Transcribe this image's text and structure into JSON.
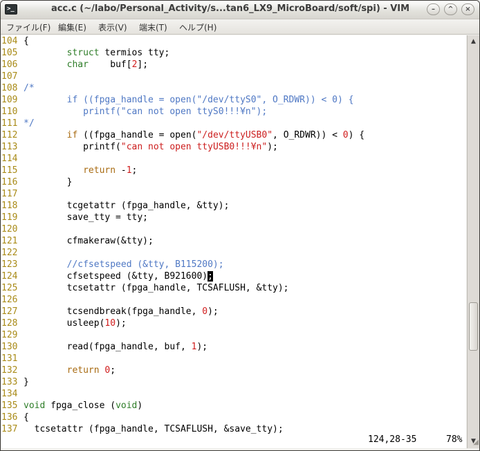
{
  "window": {
    "title": "acc.c (~/labo/Personal_Activity/s...tan6_LX9_MicroBoard/soft/spi) - VIM",
    "app_icon_glyph": ">_",
    "buttons": {
      "minimize": "–",
      "maximize": "^",
      "close": "×"
    }
  },
  "menu": [
    "ファイル(F)",
    "編集(E)",
    "表示(V)",
    "端末(T)",
    "ヘルプ(H)"
  ],
  "colors": {
    "line_number": "#a98b18",
    "type": "#2e7d28",
    "keyword": "#a86b12",
    "number": "#d01c1c",
    "string": "#cc1e1e",
    "comment": "#4f78c4"
  },
  "editor": {
    "lines": [
      {
        "n": "104",
        "seg": [
          {
            "t": "{"
          }
        ]
      },
      {
        "n": "105",
        "seg": [
          {
            "t": "        "
          },
          {
            "t": "struct",
            "c": "type"
          },
          {
            "t": " termios tty;"
          }
        ]
      },
      {
        "n": "106",
        "seg": [
          {
            "t": "        "
          },
          {
            "t": "char",
            "c": "type"
          },
          {
            "t": "    buf["
          },
          {
            "t": "2",
            "c": "num"
          },
          {
            "t": "];"
          }
        ]
      },
      {
        "n": "107",
        "seg": [
          {
            "t": ""
          }
        ]
      },
      {
        "n": "108",
        "seg": [
          {
            "t": "/*",
            "c": "cmt"
          }
        ]
      },
      {
        "n": "109",
        "seg": [
          {
            "t": "        if ((fpga_handle = open(\"/dev/ttyS0\", O_RDWR)) < 0) {",
            "c": "cmt"
          }
        ]
      },
      {
        "n": "110",
        "seg": [
          {
            "t": "           printf(\"can not open ttyS0!!!¥n\");",
            "c": "cmt"
          }
        ]
      },
      {
        "n": "111",
        "seg": [
          {
            "t": "*/",
            "c": "cmt"
          }
        ]
      },
      {
        "n": "112",
        "seg": [
          {
            "t": "        "
          },
          {
            "t": "if",
            "c": "kw"
          },
          {
            "t": " ((fpga_handle = open("
          },
          {
            "t": "\"/dev/ttyUSB0\"",
            "c": "str"
          },
          {
            "t": ", O_RDWR)) < "
          },
          {
            "t": "0",
            "c": "num"
          },
          {
            "t": ") {"
          }
        ]
      },
      {
        "n": "113",
        "seg": [
          {
            "t": "           printf("
          },
          {
            "t": "\"can not open ttyUSB0!!!¥n\"",
            "c": "str"
          },
          {
            "t": ");"
          }
        ]
      },
      {
        "n": "114",
        "seg": [
          {
            "t": ""
          }
        ]
      },
      {
        "n": "115",
        "seg": [
          {
            "t": "           "
          },
          {
            "t": "return",
            "c": "kw"
          },
          {
            "t": " -"
          },
          {
            "t": "1",
            "c": "num"
          },
          {
            "t": ";"
          }
        ]
      },
      {
        "n": "116",
        "seg": [
          {
            "t": "        }"
          }
        ]
      },
      {
        "n": "117",
        "seg": [
          {
            "t": ""
          }
        ]
      },
      {
        "n": "118",
        "seg": [
          {
            "t": "        tcgetattr (fpga_handle, &tty);"
          }
        ]
      },
      {
        "n": "119",
        "seg": [
          {
            "t": "        save_tty = tty;"
          }
        ]
      },
      {
        "n": "120",
        "seg": [
          {
            "t": ""
          }
        ]
      },
      {
        "n": "121",
        "seg": [
          {
            "t": "        cfmakeraw(&tty);"
          }
        ]
      },
      {
        "n": "122",
        "seg": [
          {
            "t": ""
          }
        ]
      },
      {
        "n": "123",
        "seg": [
          {
            "t": "        //cfsetspeed (&tty, B115200);",
            "c": "cmt"
          }
        ]
      },
      {
        "n": "124",
        "seg": [
          {
            "t": "        cfsetspeed (&tty, B921600)"
          },
          {
            "t": ";",
            "c": "cursor"
          }
        ]
      },
      {
        "n": "125",
        "seg": [
          {
            "t": "        tcsetattr (fpga_handle, TCSAFLUSH, &tty);"
          }
        ]
      },
      {
        "n": "126",
        "seg": [
          {
            "t": ""
          }
        ]
      },
      {
        "n": "127",
        "seg": [
          {
            "t": "        tcsendbreak(fpga_handle, "
          },
          {
            "t": "0",
            "c": "num"
          },
          {
            "t": ");"
          }
        ]
      },
      {
        "n": "128",
        "seg": [
          {
            "t": "        usleep("
          },
          {
            "t": "10",
            "c": "num"
          },
          {
            "t": ");"
          }
        ]
      },
      {
        "n": "129",
        "seg": [
          {
            "t": ""
          }
        ]
      },
      {
        "n": "130",
        "seg": [
          {
            "t": "        read(fpga_handle, buf, "
          },
          {
            "t": "1",
            "c": "num"
          },
          {
            "t": ");"
          }
        ]
      },
      {
        "n": "131",
        "seg": [
          {
            "t": ""
          }
        ]
      },
      {
        "n": "132",
        "seg": [
          {
            "t": "        "
          },
          {
            "t": "return",
            "c": "kw"
          },
          {
            "t": " "
          },
          {
            "t": "0",
            "c": "num"
          },
          {
            "t": ";"
          }
        ]
      },
      {
        "n": "133",
        "seg": [
          {
            "t": "}"
          }
        ]
      },
      {
        "n": "134",
        "seg": [
          {
            "t": ""
          }
        ]
      },
      {
        "n": "135",
        "seg": [
          {
            "t": "void",
            "c": "type"
          },
          {
            "t": " fpga_close ("
          },
          {
            "t": "void",
            "c": "type"
          },
          {
            "t": ")"
          }
        ]
      },
      {
        "n": "136",
        "seg": [
          {
            "t": "{"
          }
        ]
      },
      {
        "n": "137",
        "seg": [
          {
            "t": "  tcsetattr (fpga_handle, TCSAFLUSH, &save_tty);"
          }
        ]
      }
    ]
  },
  "status": {
    "position": "124,28-35",
    "percent": "78%"
  },
  "scrollbar": {
    "up_icon": "arrow-up",
    "down_icon": "arrow-down",
    "position_fraction": 0.78
  }
}
